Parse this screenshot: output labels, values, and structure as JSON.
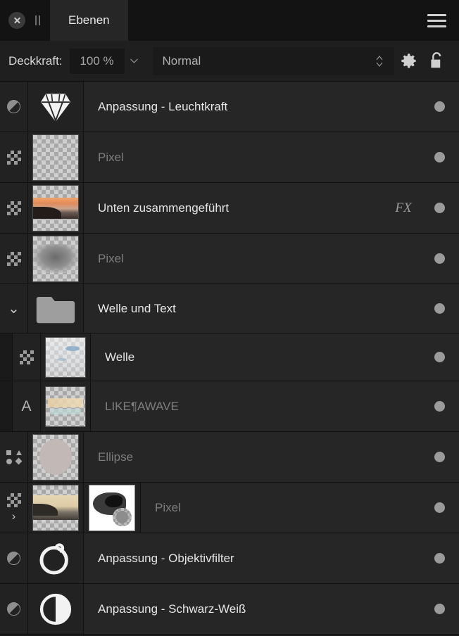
{
  "tab": {
    "close_icon": "close-icon",
    "grip_icon": "drag-handle-icon",
    "title": "Ebenen",
    "menu_icon": "hamburger-menu-icon"
  },
  "options": {
    "opacity_label": "Deckkraft:",
    "opacity_value": "100 %",
    "opacity_dropdown_icon": "chevron-down-icon",
    "blend_mode": "Normal",
    "blend_stepper_icon": "stepper-up-down-icon",
    "settings_icon": "gear-icon",
    "lock_icon": "unlocked-padlock-icon"
  },
  "colors": {
    "panel_bg": "#1a1a1a",
    "row_bg": "#262626",
    "header_bg": "#131313",
    "text": "#e6e6e6",
    "text_dim": "#7d7d7d",
    "visibility_dot": "#9b9b9b"
  },
  "layers": [
    {
      "name": "Anpassung - Leuchtkraft",
      "type_icon": "adjustment-layer-icon",
      "thumb_icon": "diamond-luminosity-icon",
      "dim": false,
      "indent": 0,
      "fx": "",
      "visible": true
    },
    {
      "name": "Pixel",
      "type_icon": "pixel-layer-icon",
      "thumb_icon": "empty-transparent-thumbnail",
      "dim": true,
      "indent": 0,
      "fx": "",
      "visible": true
    },
    {
      "name": "Unten zusammengeführt",
      "type_icon": "pixel-layer-icon",
      "thumb_icon": "sunset-photo-thumbnail",
      "dim": false,
      "indent": 0,
      "fx": "FX",
      "visible": true
    },
    {
      "name": "Pixel",
      "type_icon": "pixel-layer-icon",
      "thumb_icon": "gradient-blur-thumbnail",
      "dim": true,
      "indent": 0,
      "fx": "",
      "visible": true
    },
    {
      "name": "Welle und Text",
      "type_icon": "group-expand-chevron-icon",
      "thumb_icon": "folder-icon",
      "dim": false,
      "indent": 0,
      "fx": "",
      "visible": true
    },
    {
      "name": "Welle",
      "type_icon": "pixel-layer-icon",
      "thumb_icon": "wave-thumbnail",
      "dim": false,
      "indent": 1,
      "fx": "",
      "visible": true
    },
    {
      "name": "LIKE¶AWAVE",
      "type_icon": "text-layer-icon",
      "thumb_icon": "text-thumbnail",
      "dim": true,
      "indent": 1,
      "fx": "",
      "visible": true
    },
    {
      "name": "Ellipse",
      "type_icon": "shape-layer-icon",
      "thumb_icon": "ellipse-thumbnail",
      "dim": true,
      "indent": 0,
      "fx": "",
      "visible": true
    },
    {
      "name": "Pixel",
      "type_icon": "pixel-layer-icon",
      "thumb_icon": "beach-photo-thumbnail",
      "dim": true,
      "indent": 0,
      "fx": "",
      "visible": true,
      "has_mask": true,
      "mask_icon": "layer-mask-thumbnail",
      "expand_icon": "expand-right-chevron-icon"
    },
    {
      "name": "Anpassung - Objektivfilter",
      "type_icon": "adjustment-layer-icon",
      "thumb_icon": "lens-filter-icon",
      "dim": false,
      "indent": 0,
      "fx": "",
      "visible": true
    },
    {
      "name": "Anpassung - Schwarz-Weiß",
      "type_icon": "adjustment-layer-icon",
      "thumb_icon": "black-white-circle-icon",
      "dim": false,
      "indent": 0,
      "fx": "",
      "visible": true
    }
  ]
}
